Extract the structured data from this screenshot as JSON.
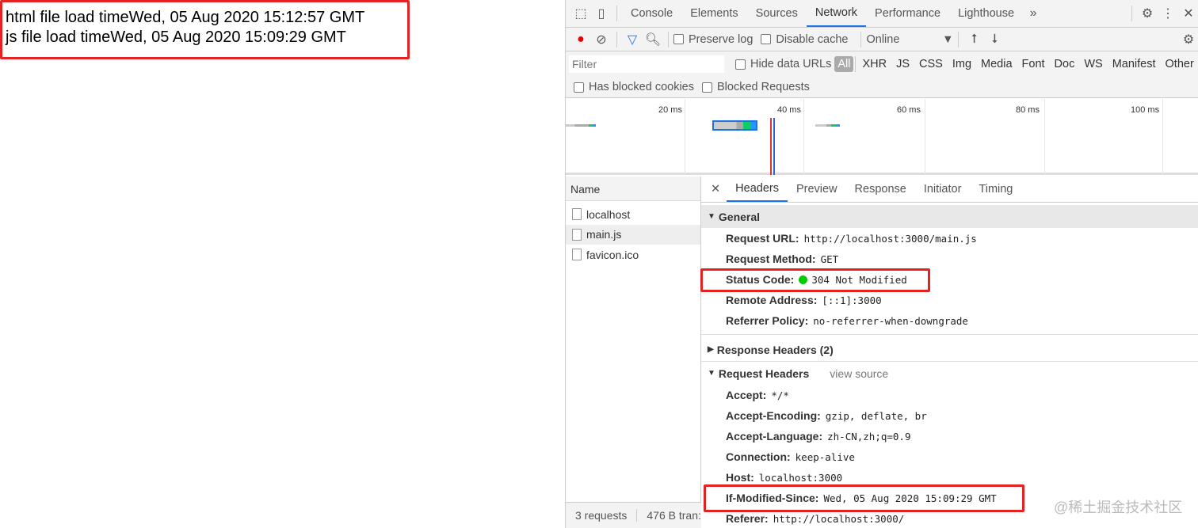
{
  "page": {
    "lines": [
      "html file load timeWed, 05 Aug 2020 15:12:57 GMT",
      "js file load timeWed, 05 Aug 2020 15:09:29 GMT"
    ]
  },
  "devtools": {
    "tabs": [
      "Console",
      "Elements",
      "Sources",
      "Network",
      "Performance",
      "Lighthouse"
    ],
    "active_tab": "Network",
    "toolbar": {
      "preserve_log": "Preserve log",
      "disable_cache": "Disable cache",
      "throttle": "Online"
    },
    "filter": {
      "placeholder": "Filter",
      "hide_data_urls": "Hide data URLs",
      "types": [
        "All",
        "XHR",
        "JS",
        "CSS",
        "Img",
        "Media",
        "Font",
        "Doc",
        "WS",
        "Manifest",
        "Other"
      ],
      "has_blocked_cookies": "Has blocked cookies",
      "blocked_requests": "Blocked Requests"
    },
    "overview": {
      "ticks": [
        "20 ms",
        "40 ms",
        "60 ms",
        "80 ms",
        "100 ms"
      ]
    },
    "names": {
      "header": "Name",
      "items": [
        "localhost",
        "main.js",
        "favicon.ico"
      ],
      "selected": "main.js"
    },
    "footer": {
      "requests": "3 requests",
      "transferred": "476 B tran:"
    },
    "details": {
      "tabs": [
        "Headers",
        "Preview",
        "Response",
        "Initiator",
        "Timing"
      ],
      "general_title": "General",
      "general": [
        {
          "k": "Request URL:",
          "v": "http://localhost:3000/main.js"
        },
        {
          "k": "Request Method:",
          "v": "GET"
        },
        {
          "k": "Status Code:",
          "v": "304 Not Modified"
        },
        {
          "k": "Remote Address:",
          "v": "[::1]:3000"
        },
        {
          "k": "Referrer Policy:",
          "v": "no-referrer-when-downgrade"
        }
      ],
      "response_headers_title": "Response Headers (2)",
      "request_headers_title": "Request Headers",
      "view_source": "view source",
      "request": [
        {
          "k": "Accept:",
          "v": "*/*"
        },
        {
          "k": "Accept-Encoding:",
          "v": "gzip, deflate, br"
        },
        {
          "k": "Accept-Language:",
          "v": "zh-CN,zh;q=0.9"
        },
        {
          "k": "Connection:",
          "v": "keep-alive"
        },
        {
          "k": "Host:",
          "v": "localhost:3000"
        },
        {
          "k": "If-Modified-Since:",
          "v": "Wed, 05 Aug 2020 15:09:29 GMT"
        },
        {
          "k": "Referer:",
          "v": "http://localhost:3000/"
        }
      ]
    }
  },
  "watermark": "@稀土掘金技术社区",
  "colors": {
    "highlight": "#e52222",
    "accent": "#1a73e8",
    "status_ok": "#00cc00"
  }
}
